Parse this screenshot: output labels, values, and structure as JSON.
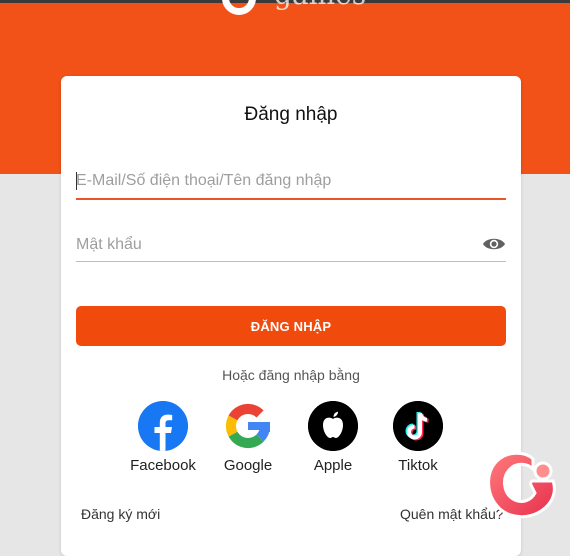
{
  "brand": {
    "logo_text": "games",
    "color": "#f25117"
  },
  "login": {
    "title": "Đăng nhập",
    "email_placeholder": "E-Mail/Số điện thoại/Tên đăng nhập",
    "password_placeholder": "Mật khẩu",
    "submit_label": "ĐĂNG NHẬP",
    "or_text": "Hoặc đăng nhập bằng",
    "register_link": "Đăng ký mới",
    "forgot_link": "Quên mật khẩu?"
  },
  "social": [
    {
      "label": "Facebook",
      "icon": "facebook-icon"
    },
    {
      "label": "Google",
      "icon": "google-icon"
    },
    {
      "label": "Apple",
      "icon": "apple-icon"
    },
    {
      "label": "Tiktok",
      "icon": "tiktok-icon"
    }
  ],
  "colors": {
    "accent": "#f04a0c",
    "hero": "#f25117",
    "page_bg": "#e6e6e6"
  }
}
